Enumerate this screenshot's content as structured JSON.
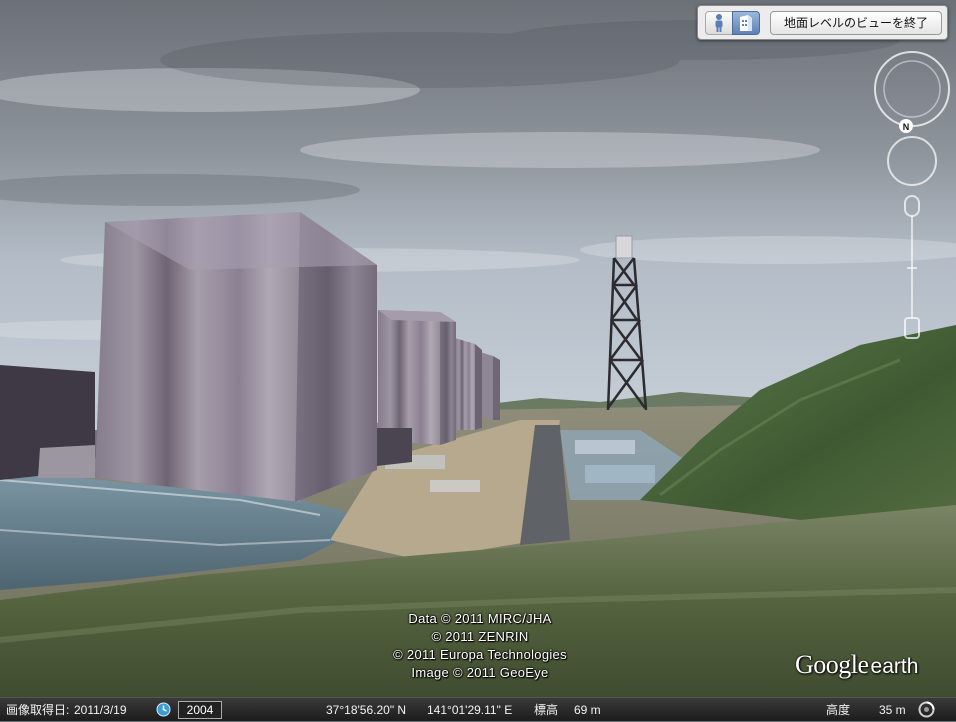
{
  "toolbar": {
    "person_icon": "person-icon",
    "building_icon": "building-icon",
    "exit_ground_view_label": "地面レベルのビューを終了"
  },
  "navigation": {
    "north_label": "N"
  },
  "attribution": {
    "lines": [
      "Data © 2011 MIRC/JHA",
      "© 2011 ZENRIN",
      "© 2011 Europa Technologies",
      "Image © 2011 GeoEye"
    ]
  },
  "logo": {
    "google": "Google",
    "earth": "earth"
  },
  "status_bar": {
    "imagery_date_label": "画像取得日:",
    "imagery_date": "2011/3/19",
    "historical_year": "2004",
    "latitude": "37°18'56.20\" N",
    "longitude": "141°01'29.11\" E",
    "elevation_label": "標高",
    "elevation_value": "69 m",
    "altitude_label": "高度",
    "altitude_value": "35 m"
  },
  "colors": {
    "sky_top": "#6f737a",
    "building": "#8a8290",
    "hill": "#4e6a3c",
    "status_bar": "#262626"
  }
}
